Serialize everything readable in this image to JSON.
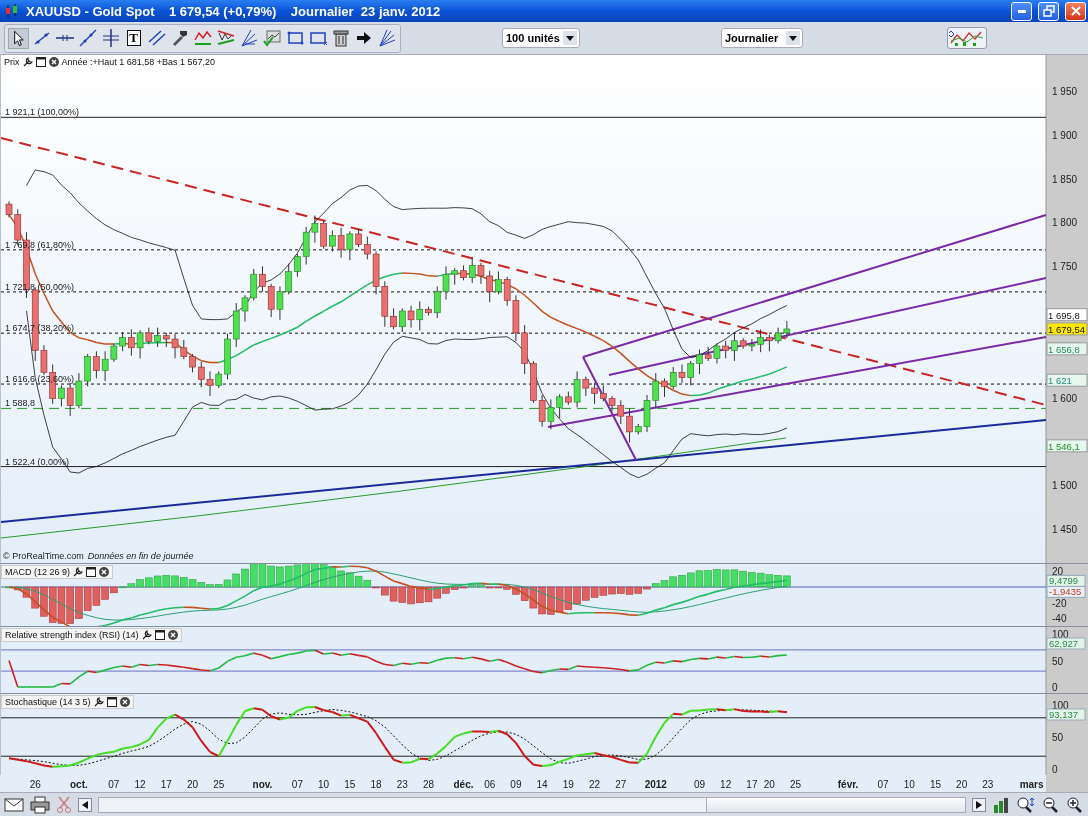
{
  "window": {
    "title": "XAUUSD - Gold Spot    1 679,54 (+0,79%)    Journalier  23 janv. 2012"
  },
  "toolbar": {
    "text_tool": "T",
    "quantity": "100 unités",
    "timeframe": "Journalier"
  },
  "price_panel": {
    "label": "Prix",
    "info": "Année :+Haut 1 681,58 +Bas 1 567,20",
    "footer_source": "© ProRealTime.com",
    "footer_note": "Données en fin de journée",
    "axis": [
      "1 950",
      "1 900",
      "1 850",
      "1 800",
      "1 750",
      "1 600",
      "1 500",
      "1 450"
    ],
    "levels": [
      {
        "label": "1 921,1 (100,00%)",
        "kind": "solid"
      },
      {
        "label": "1 769,8 (61,80%)",
        "kind": "dotted"
      },
      {
        "label": "1 721,8 (50,00%)",
        "kind": "dotted"
      },
      {
        "label": "1 674,7 (38,20%)",
        "kind": "dotted"
      },
      {
        "label": "1 616,6 (23,60%)",
        "kind": "dotted"
      },
      {
        "label": "1 588,8",
        "kind": "dashed"
      },
      {
        "label": "1 522,4 (0,00%)",
        "kind": "solid"
      }
    ],
    "price_tags": [
      {
        "text": "1 695,8",
        "color": "#ffffff"
      },
      {
        "text": "1 679,54",
        "color": "#ffe800"
      },
      {
        "text": "1 656,8",
        "color": "#e6f7ef"
      },
      {
        "text": "1 621",
        "color": "#e6f7ef"
      },
      {
        "text": "1 546,1",
        "color": "#e6f7ef"
      }
    ]
  },
  "macd": {
    "label": "MACD (12 26 9)",
    "axis": [
      "20",
      "-20",
      "-40"
    ],
    "readouts": [
      "9,4799",
      "-1,9435"
    ]
  },
  "rsi": {
    "label": "Relative strength index (RSI) (14)",
    "axis": [
      "100",
      "50",
      "0"
    ],
    "readouts": [
      "62,927"
    ]
  },
  "stochastic": {
    "label": "Stochastique (14 3 5)",
    "axis": [
      "100",
      "50",
      "0"
    ],
    "readouts": [
      "93,137"
    ]
  },
  "date_axis": [
    {
      "label": "26",
      "kind": "day"
    },
    {
      "label": "oct.",
      "kind": "month"
    },
    {
      "label": "07",
      "kind": "day"
    },
    {
      "label": "12",
      "kind": "day"
    },
    {
      "label": "17",
      "kind": "day"
    },
    {
      "label": "20",
      "kind": "day"
    },
    {
      "label": "25",
      "kind": "day"
    },
    {
      "label": "nov.",
      "kind": "month"
    },
    {
      "label": "07",
      "kind": "day"
    },
    {
      "label": "10",
      "kind": "day"
    },
    {
      "label": "15",
      "kind": "day"
    },
    {
      "label": "18",
      "kind": "day"
    },
    {
      "label": "23",
      "kind": "day"
    },
    {
      "label": "28",
      "kind": "day"
    },
    {
      "label": "déc.",
      "kind": "month"
    },
    {
      "label": "06",
      "kind": "day"
    },
    {
      "label": "09",
      "kind": "day"
    },
    {
      "label": "14",
      "kind": "day"
    },
    {
      "label": "19",
      "kind": "day"
    },
    {
      "label": "22",
      "kind": "day"
    },
    {
      "label": "27",
      "kind": "day"
    },
    {
      "label": "2012",
      "kind": "month"
    },
    {
      "label": "09",
      "kind": "day"
    },
    {
      "label": "12",
      "kind": "day"
    },
    {
      "label": "17",
      "kind": "day"
    },
    {
      "label": "20",
      "kind": "day"
    },
    {
      "label": "25",
      "kind": "day"
    },
    {
      "label": "févr.",
      "kind": "month"
    },
    {
      "label": "07",
      "kind": "day"
    },
    {
      "label": "10",
      "kind": "day"
    },
    {
      "label": "15",
      "kind": "day"
    },
    {
      "label": "20",
      "kind": "day"
    },
    {
      "label": "23",
      "kind": "day"
    },
    {
      "label": "mars",
      "kind": "month"
    }
  ]
}
